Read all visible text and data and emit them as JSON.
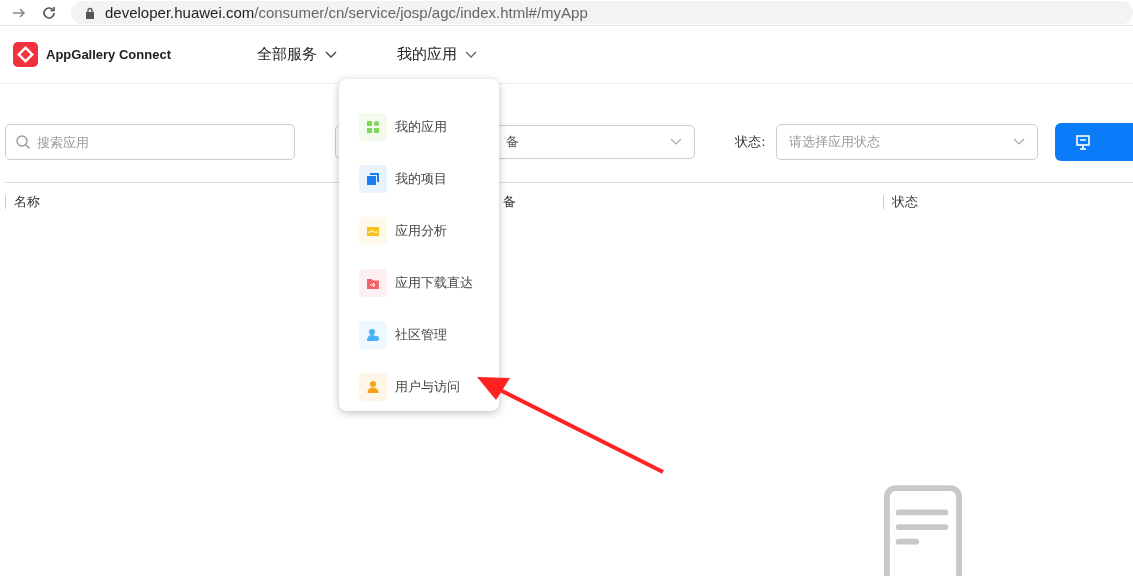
{
  "browser": {
    "url_host": "developer.huawei.com",
    "url_path": "/consumer/cn/service/josp/agc/index.html#/myApp"
  },
  "header": {
    "brand": "AppGallery Connect",
    "nav": [
      {
        "label": "全部服务",
        "expanded": false
      },
      {
        "label": "我的应用",
        "expanded": true
      }
    ]
  },
  "filters": {
    "search": {
      "placeholder": "搜索应用"
    },
    "device_select": {
      "value": "备"
    },
    "status_label": "状态:",
    "status_select": {
      "placeholder": "请选择应用状态"
    }
  },
  "table": {
    "columns": [
      "名称",
      "备",
      "状态"
    ]
  },
  "menu": {
    "items": [
      {
        "label": "我的应用",
        "kind": "apps",
        "color": "#7ed957"
      },
      {
        "label": "我的项目",
        "kind": "projects",
        "color": "#1a7df2"
      },
      {
        "label": "应用分析",
        "kind": "analytics",
        "color": "#f5c21b"
      },
      {
        "label": "应用下载直达",
        "kind": "download",
        "color": "#f2636b"
      },
      {
        "label": "社区管理",
        "kind": "community",
        "color": "#46b3f0"
      },
      {
        "label": "用户与访问",
        "kind": "users",
        "color": "#f7a21a"
      }
    ]
  },
  "annotation": {
    "kind": "arrow"
  }
}
